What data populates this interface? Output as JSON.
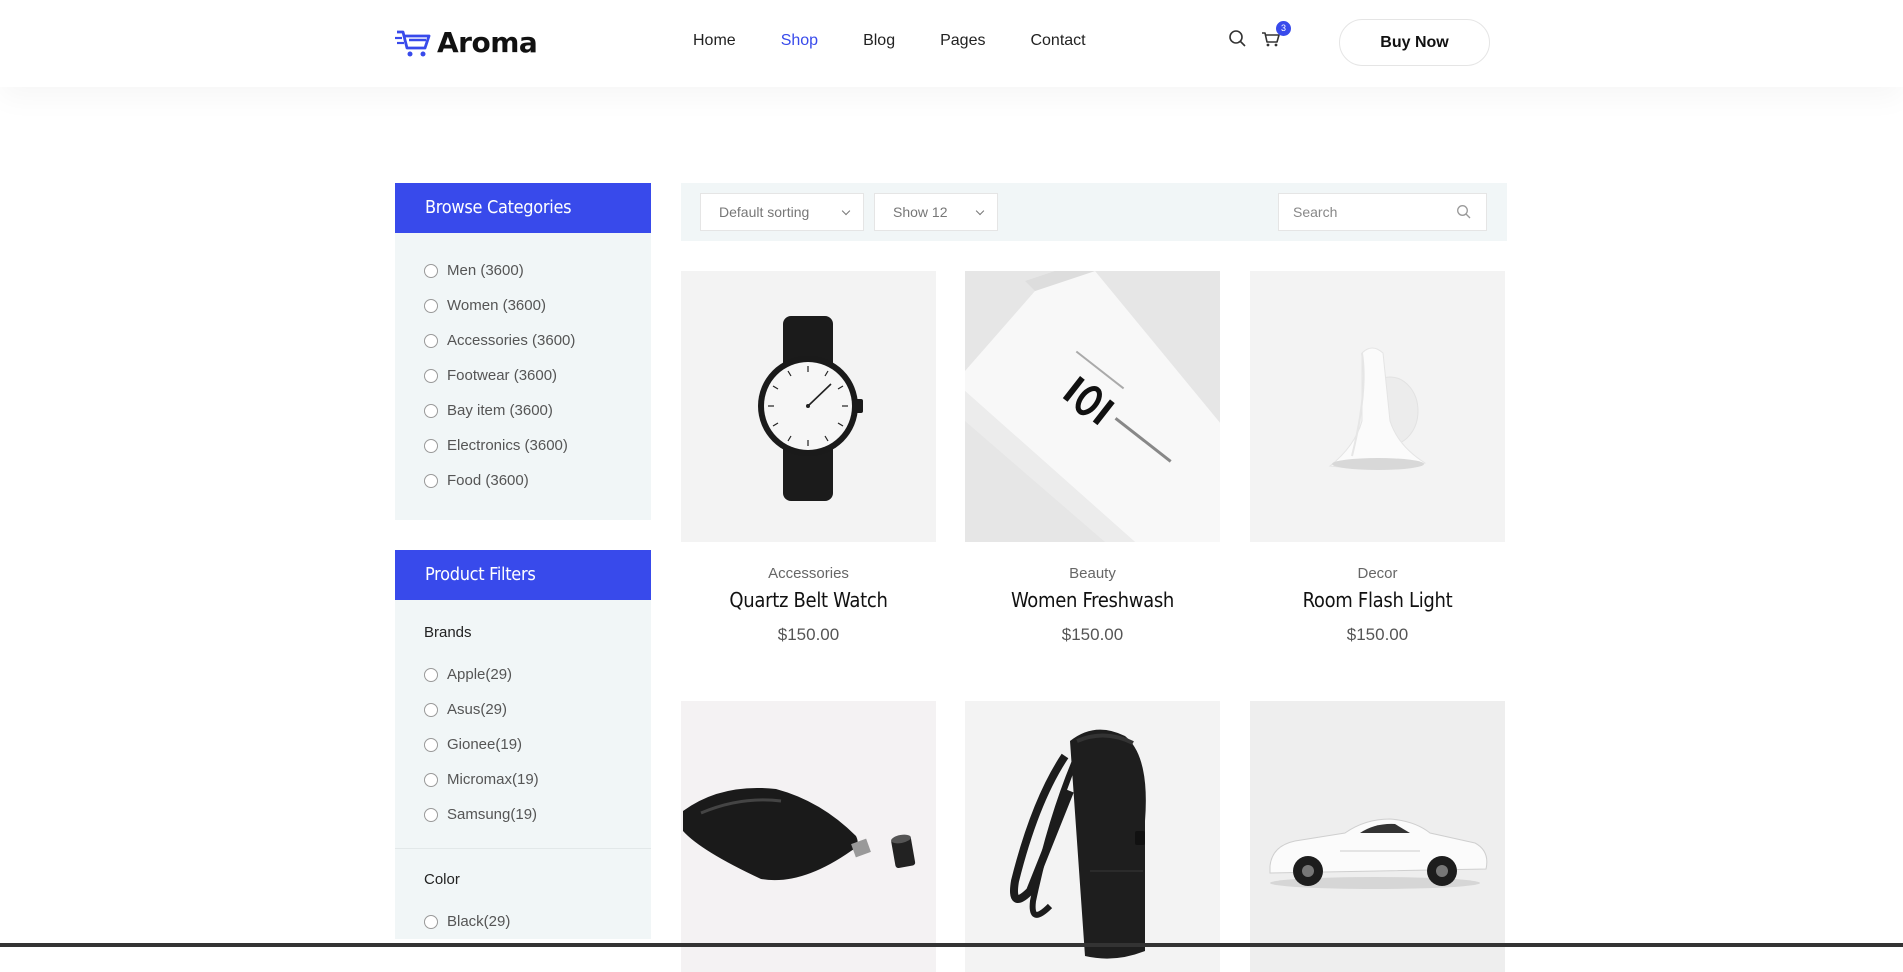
{
  "brand": {
    "name": "Aroma",
    "accent": "#384aeb"
  },
  "nav": {
    "items": [
      {
        "label": "Home",
        "active": false
      },
      {
        "label": "Shop",
        "active": true
      },
      {
        "label": "Blog",
        "active": false
      },
      {
        "label": "Pages",
        "active": false
      },
      {
        "label": "Contact",
        "active": false
      }
    ]
  },
  "header": {
    "cart_count": "3",
    "buy_label": "Buy Now",
    "icons": [
      "search-icon",
      "cart-icon"
    ]
  },
  "categories": {
    "title": "Browse Categories",
    "items": [
      "Men (3600)",
      "Women (3600)",
      "Accessories (3600)",
      "Footwear (3600)",
      "Bay item (3600)",
      "Electronics (3600)",
      "Food (3600)"
    ]
  },
  "filters": {
    "title": "Product Filters",
    "brands_title": "Brands",
    "brands": [
      "Apple(29)",
      "Asus(29)",
      "Gionee(19)",
      "Micromax(19)",
      "Samsung(19)"
    ],
    "color_title": "Color",
    "colors": [
      "Black(29)"
    ]
  },
  "toolbar": {
    "sorting": "Default sorting",
    "show": "Show 12",
    "search_placeholder": "Search"
  },
  "products": [
    {
      "category": "Accessories",
      "name": "Quartz Belt Watch",
      "price": "$150.00",
      "image": "watch"
    },
    {
      "category": "Beauty",
      "name": "Women Freshwash",
      "price": "$150.00",
      "image": "tube"
    },
    {
      "category": "Decor",
      "name": "Room Flash Light",
      "price": "$150.00",
      "image": "lamp"
    },
    {
      "image": "flask"
    },
    {
      "image": "backpack"
    },
    {
      "image": "car"
    }
  ]
}
